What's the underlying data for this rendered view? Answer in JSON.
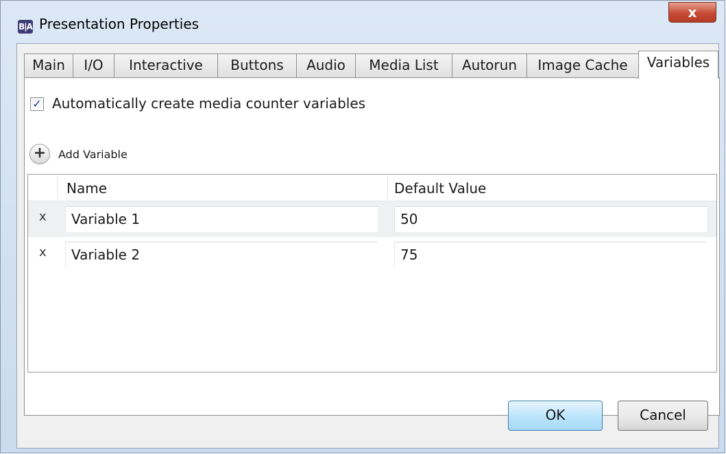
{
  "window": {
    "title": "Presentation Properties",
    "app_icon_text": "B|A",
    "close_glyph": "x"
  },
  "tabs": [
    {
      "label": "Main"
    },
    {
      "label": "I/O"
    },
    {
      "label": "Interactive"
    },
    {
      "label": "Buttons"
    },
    {
      "label": "Audio"
    },
    {
      "label": "Media List"
    },
    {
      "label": "Autorun"
    },
    {
      "label": "Image Cache"
    },
    {
      "label": "Variables",
      "active": true
    }
  ],
  "variables_tab": {
    "auto_create_label": "Automatically create media counter variables",
    "auto_create_checked": true,
    "checkmark": "✓",
    "add_variable_label": "Add Variable",
    "add_icon_glyph": "+",
    "grid": {
      "headers": {
        "name": "Name",
        "default_value": "Default Value"
      },
      "delete_glyph": "x",
      "rows": [
        {
          "name": "Variable 1",
          "default_value": "50"
        },
        {
          "name": "Variable 2",
          "default_value": "75"
        }
      ]
    }
  },
  "buttons": {
    "ok": "OK",
    "cancel": "Cancel"
  },
  "colors": {
    "accent_ok_border": "#3c7fb1",
    "close_red": "#c74c36",
    "checkbox_check": "#22449a"
  },
  "icons": {
    "app": "ba-app-icon",
    "close": "close-icon",
    "add": "plus-circle-icon",
    "delete": "delete-x-icon",
    "check": "checkmark-icon"
  }
}
